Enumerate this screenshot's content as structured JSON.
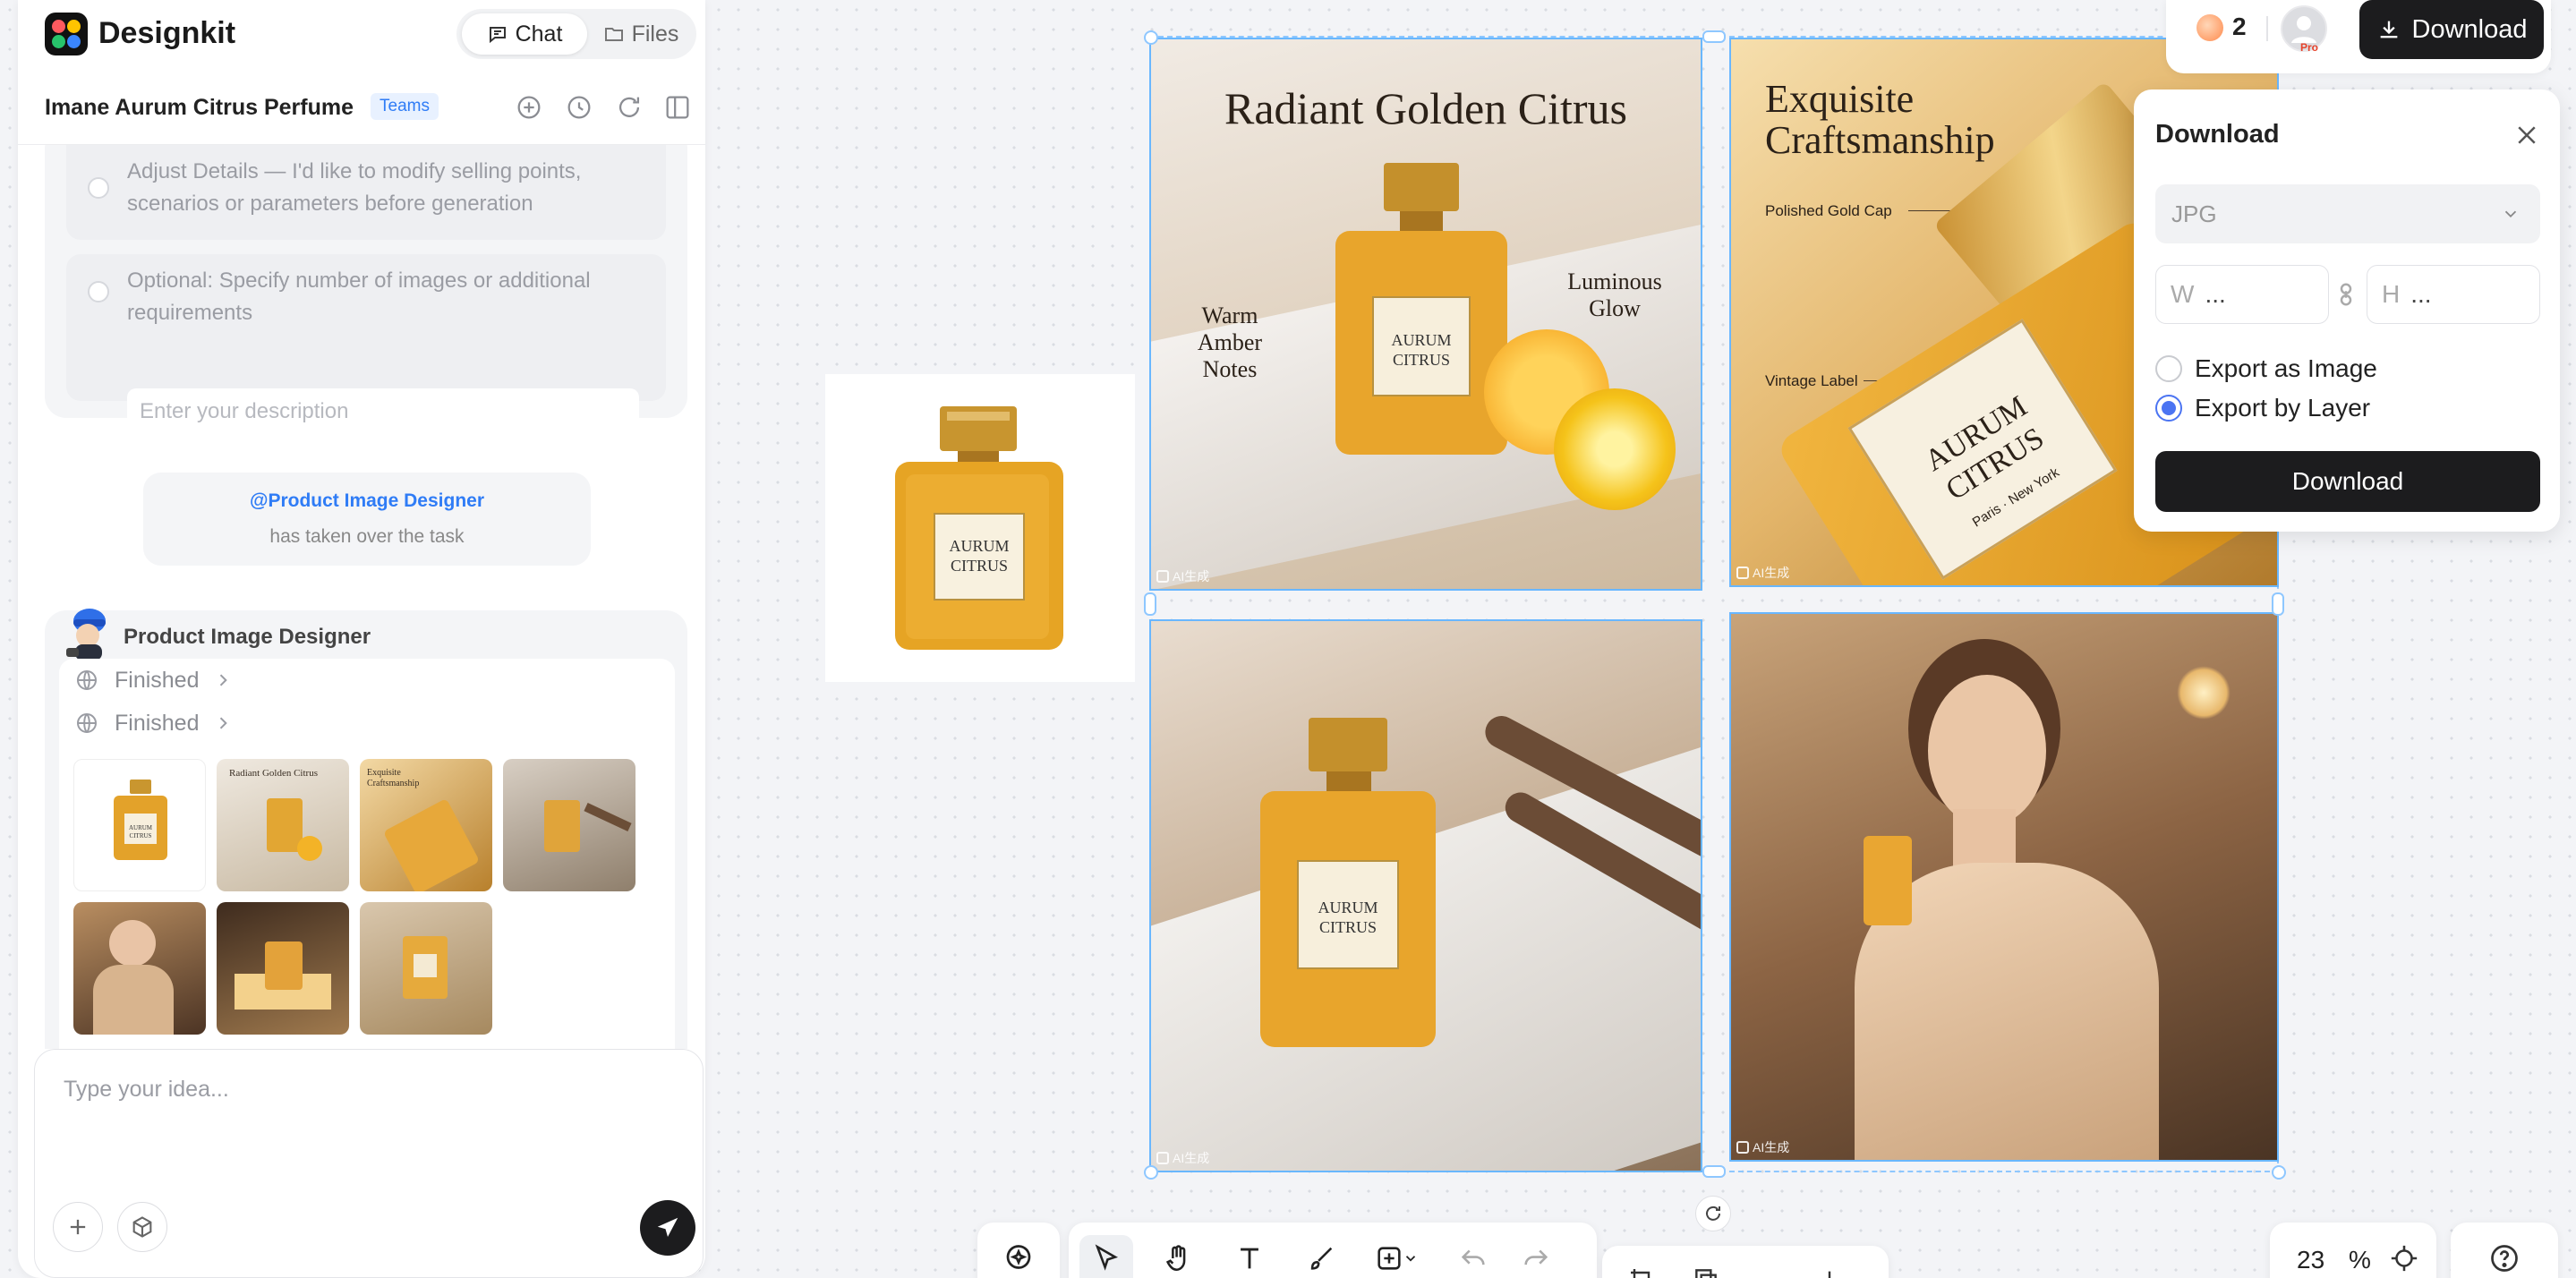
{
  "app": {
    "brand": "Designkit"
  },
  "header": {
    "tabs": [
      {
        "label": "Chat",
        "active": true
      },
      {
        "label": "Files",
        "active": false
      }
    ],
    "project_title": "Imane Aurum Citrus Perfume",
    "badge": "Teams"
  },
  "chat": {
    "options": [
      {
        "label": "Adjust Details — I'd like to modify selling points, scenarios or parameters before generation"
      },
      {
        "label": "Optional: Specify number of images or additional requirements"
      }
    ],
    "description_placeholder": "Enter your description",
    "handoff": {
      "agent": "@Product Image Designer",
      "message": "has taken over the task"
    },
    "designer": {
      "name": "Product Image Designer",
      "steps": [
        {
          "label": "Finished"
        },
        {
          "label": "Finished"
        }
      ],
      "thumbnails": [
        {
          "caption": ""
        },
        {
          "caption": "Radiant Golden Citrus"
        },
        {
          "caption": "Exquisite Craftsmanship"
        },
        {
          "caption": ""
        },
        {
          "caption": ""
        },
        {
          "caption": ""
        },
        {
          "caption": ""
        }
      ]
    },
    "composer_placeholder": "Type your idea..."
  },
  "canvas": {
    "tiles": [
      {
        "title": "Radiant Golden Citrus",
        "callouts": [
          "Warm Amber Notes",
          "Luminous Glow"
        ],
        "label": {
          "top": "AURUM",
          "bottom": "CITRUS"
        }
      },
      {
        "title": "Exquisite Craftsmanship",
        "callouts": [
          "Polished Gold Cap",
          "Vintage Label"
        ],
        "label": {
          "top": "AURUM",
          "bottom": "CITRUS",
          "sub": "Paris · New York"
        }
      },
      {
        "label": {
          "top": "AURUM",
          "bottom": "CITRUS"
        }
      },
      {}
    ],
    "product_label": {
      "top": "AURUM",
      "bottom": "CITRUS"
    },
    "ai_tag": "AI生成"
  },
  "topbar": {
    "credits": "2",
    "pro": "Pro",
    "download_label": "Download"
  },
  "download_panel": {
    "title": "Download",
    "format": "JPG",
    "width_label": "W",
    "width_value": "...",
    "height_label": "H",
    "height_value": "...",
    "export_options": [
      {
        "label": "Export as Image",
        "selected": false
      },
      {
        "label": "Export by Layer",
        "selected": true
      }
    ],
    "action_label": "Download"
  },
  "zoom": {
    "value": "23",
    "unit": "%"
  },
  "colors": {
    "accent": "#2f7cf6",
    "selection": "#69b7ff",
    "primary_dark": "#1c1c1e",
    "radio_on": "#4b74f2"
  }
}
